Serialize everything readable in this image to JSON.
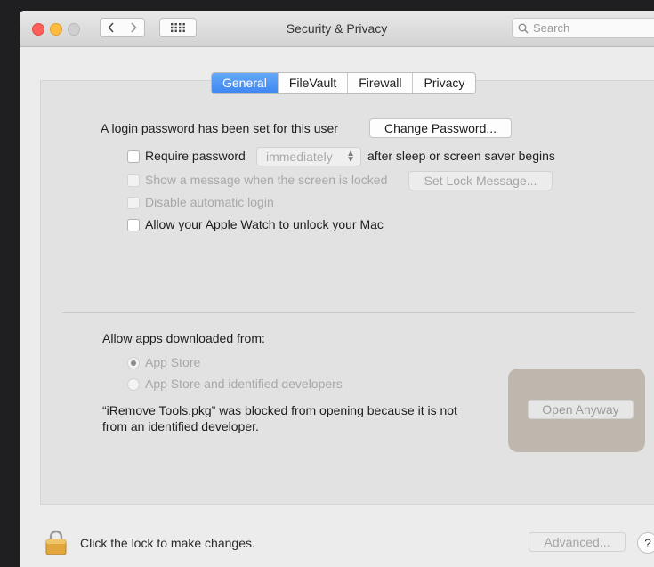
{
  "window": {
    "title": "Security & Privacy"
  },
  "search": {
    "placeholder": "Search"
  },
  "tabs": [
    {
      "label": "General",
      "active": true
    },
    {
      "label": "FileVault",
      "active": false
    },
    {
      "label": "Firewall",
      "active": false
    },
    {
      "label": "Privacy",
      "active": false
    }
  ],
  "general": {
    "login_text": "A login password has been set for this user",
    "change_password_label": "Change Password...",
    "require_password_label": "Require password",
    "require_password_value": "immediately",
    "after_sleep_label": "after sleep or screen saver begins",
    "show_message_label": "Show a message when the screen is locked",
    "set_lock_message_label": "Set Lock Message...",
    "disable_auto_login_label": "Disable automatic login",
    "apple_watch_label": "Allow your Apple Watch to unlock your Mac"
  },
  "downloads": {
    "heading": "Allow apps downloaded from:",
    "option_app_store": "App Store",
    "option_identified": "App Store and identified developers",
    "selected": "App Store",
    "blocked_line1": "“iRemove Tools.pkg” was blocked from opening because it is not",
    "blocked_line2": "from an identified developer.",
    "open_anyway_label": "Open Anyway"
  },
  "footer": {
    "lock_text": "Click the lock to make changes.",
    "advanced_label": "Advanced...",
    "help_label": "?"
  },
  "colors": {
    "accent": "#3d86f2",
    "highlight": "#bdb7ad",
    "close": "#fc605b",
    "minimize": "#fdbc40"
  }
}
